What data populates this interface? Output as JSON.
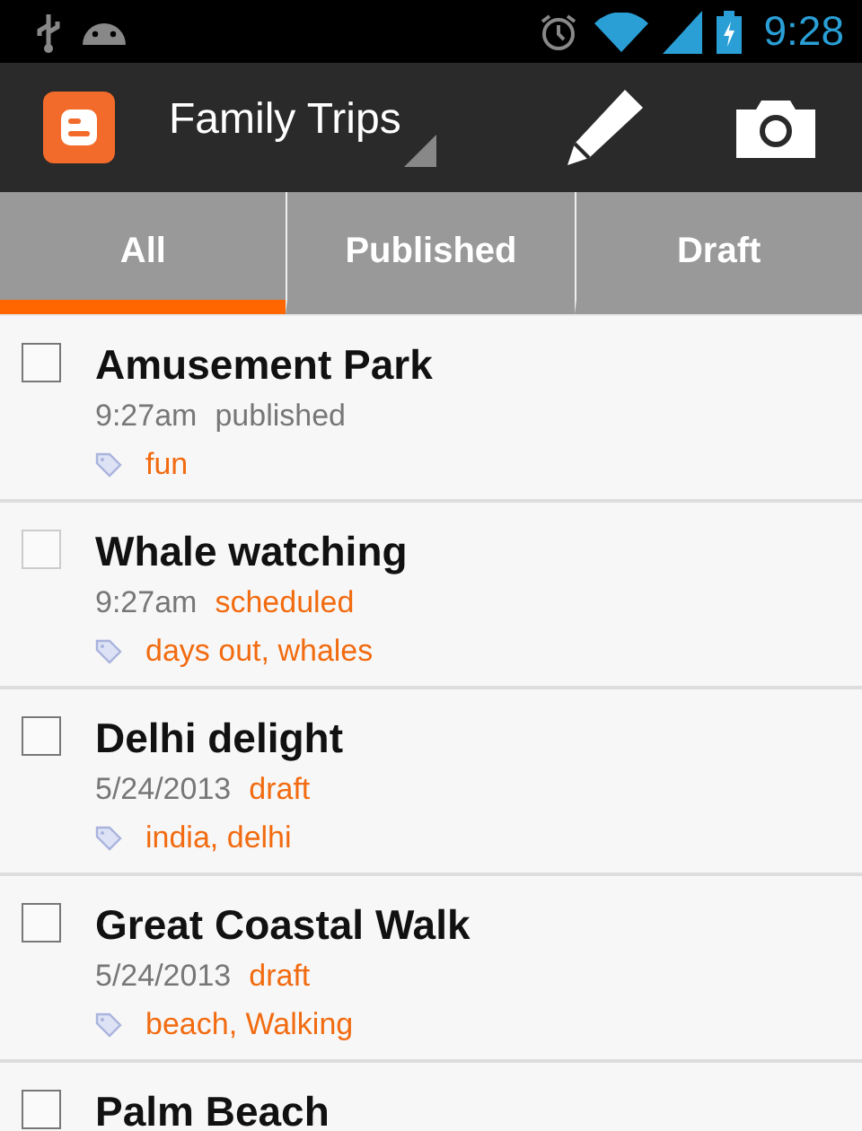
{
  "status_bar": {
    "time": "9:28"
  },
  "action_bar": {
    "blog_title": "Family Trips"
  },
  "tabs": [
    {
      "label": "All",
      "selected": true
    },
    {
      "label": "Published",
      "selected": false
    },
    {
      "label": "Draft",
      "selected": false
    }
  ],
  "posts": [
    {
      "title": "Amusement Park",
      "time": "9:27am",
      "status": "published",
      "kind": "published",
      "labels": "fun",
      "checked": false,
      "disabled": false
    },
    {
      "title": "Whale watching",
      "time": "9:27am",
      "status": "scheduled",
      "kind": "scheduled",
      "labels": "days out, whales",
      "checked": false,
      "disabled": true
    },
    {
      "title": "Delhi delight",
      "time": "5/24/2013",
      "status": "draft",
      "kind": "draft",
      "labels": "india, delhi",
      "checked": false,
      "disabled": false
    },
    {
      "title": "Great Coastal Walk",
      "time": "5/24/2013",
      "status": "draft",
      "kind": "draft",
      "labels": "beach, Walking",
      "checked": false,
      "disabled": false
    },
    {
      "title": "Palm Beach",
      "checked": false,
      "disabled": false
    }
  ]
}
